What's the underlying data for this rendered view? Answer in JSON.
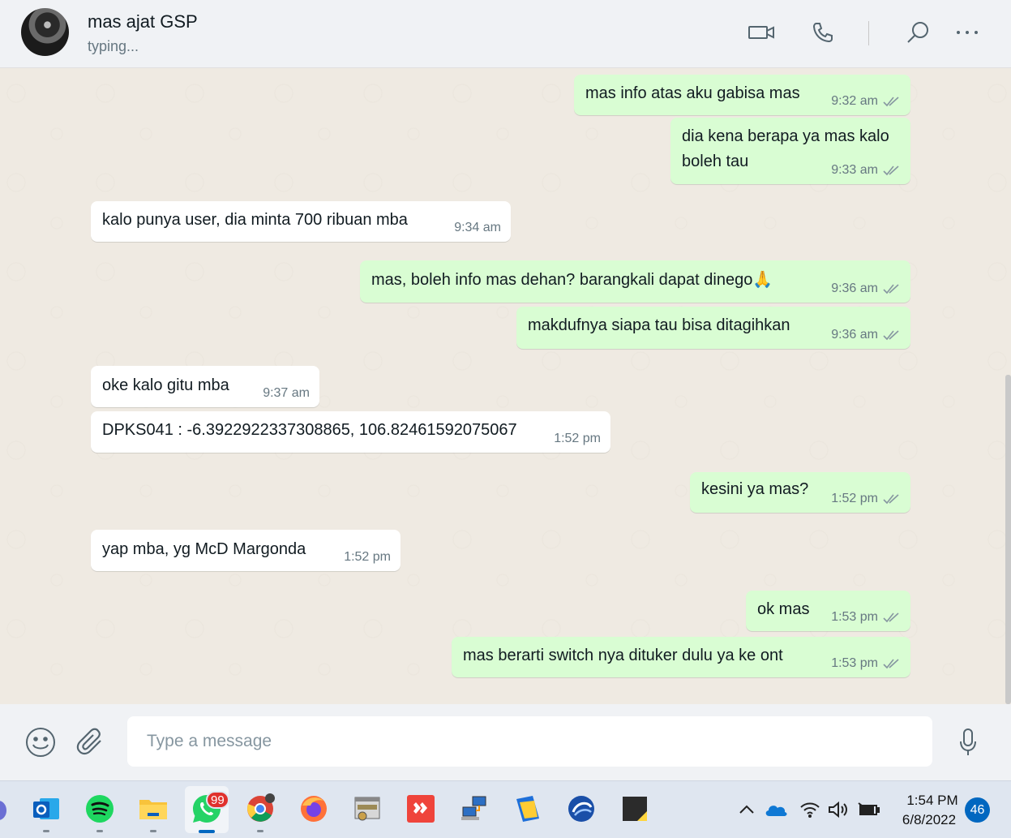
{
  "header": {
    "contact_name": "mas ajat GSP",
    "status": "typing..."
  },
  "messages": [
    {
      "dir": "out",
      "text": "mas info atas aku gabisa mas",
      "time": "9:32 am",
      "read": true
    },
    {
      "dir": "out",
      "text": "dia kena berapa ya mas kalo boleh tau",
      "time": "9:33 am",
      "read": true
    },
    {
      "dir": "in",
      "text": "kalo punya user, dia minta 700 ribuan mba",
      "time": "9:34 am"
    },
    {
      "dir": "out",
      "text": "mas, boleh info mas dehan? barangkali dapat dinego🙏",
      "time": "9:36 am",
      "read": true
    },
    {
      "dir": "out",
      "text": "makdufnya siapa tau bisa ditagihkan",
      "time": "9:36 am",
      "read": true
    },
    {
      "dir": "in",
      "text": "oke kalo gitu mba",
      "time": "9:37 am"
    },
    {
      "dir": "in",
      "text": "DPKS041 : -6.3922922337308865, 106.82461592075067",
      "time": "1:52 pm"
    },
    {
      "dir": "out",
      "text": "kesini ya mas?",
      "time": "1:52 pm",
      "read": true
    },
    {
      "dir": "in",
      "text": "yap mba, yg McD Margonda",
      "time": "1:52 pm"
    },
    {
      "dir": "out",
      "text": "ok mas",
      "time": "1:53 pm",
      "read": true
    },
    {
      "dir": "out",
      "text": "mas berarti switch nya dituker dulu ya ke ont",
      "time": "1:53 pm",
      "read": true
    }
  ],
  "composer": {
    "placeholder": "Type a message"
  },
  "taskbar": {
    "whatsapp_badge": "99",
    "clock_time": "1:54 PM",
    "clock_date": "6/8/2022",
    "notification_count": "46"
  },
  "colors": {
    "outgoing_bubble": "#d9fdd3",
    "incoming_bubble": "#ffffff",
    "chat_background": "#efeae2",
    "read_ticks": "#8696a0"
  }
}
